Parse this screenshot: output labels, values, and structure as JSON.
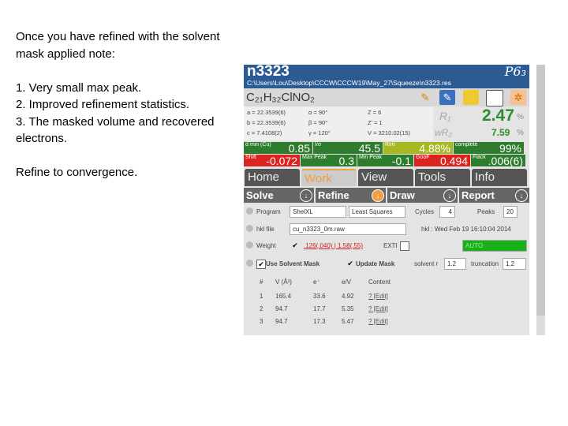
{
  "notes": {
    "intro": "Once you have refined with the solvent mask applied note:",
    "items": [
      "1.   Very small max peak.",
      "2.   Improved refinement statistics.",
      "3. The masked volume and recovered electrons."
    ],
    "outro": "Refine to convergence."
  },
  "header": {
    "title": "n3323",
    "path": "C:\\Users\\Lou\\Desktop\\CCCW\\CCCW19\\May_27\\Squeeze\\n3323.res",
    "space_group": "P6₃",
    "color": "#2c5b94"
  },
  "formula": "C₂₁H₃₂ClNO₂",
  "toolbar_icons": [
    "pencil-icon",
    "edit-structure-icon",
    "folder-icon",
    "notepad-icon",
    "molecule-icon"
  ],
  "cell": {
    "a": "a = 22.3539(6)",
    "b": "b = 22.3539(6)",
    "c": "c = 7.4108(2)",
    "alpha": "α = 90°",
    "beta": "β = 90°",
    "gamma": "γ = 120°",
    "Z": "Z = 6",
    "Zp": "Z' = 1",
    "V": "V = 3210.02(15)"
  },
  "r_factors": {
    "r1_label": "R₁",
    "r1": "2.47",
    "wr2_label": "wR₂",
    "wr2": "7.59",
    "unit": "%"
  },
  "stats_row1": [
    {
      "label": "d min (Cu)",
      "value": "0.85",
      "color": "#2e7d2e"
    },
    {
      "label": "I/σ",
      "value": "45.5",
      "color": "#2e7d2e"
    },
    {
      "label": "Rint",
      "value": "4.88%",
      "color": "#a8b820"
    },
    {
      "label": "complete",
      "value": "99%",
      "color": "#2e7d2e"
    }
  ],
  "stats_row2": [
    {
      "label": "Shift",
      "value": "-0.072",
      "color": "#d22"
    },
    {
      "label": "Max Peak",
      "value": "0.3",
      "color": "#2e7d2e"
    },
    {
      "label": "Min Peak",
      "value": "-0.1",
      "color": "#2e7d2e"
    },
    {
      "label": "GooF",
      "value": "0.494",
      "color": "#d22"
    },
    {
      "label": "Flack",
      "value": ".006(6)",
      "color": "#2e7d2e"
    }
  ],
  "tabs": [
    "Home",
    "Work",
    "View",
    "Tools",
    "Info"
  ],
  "active_tab": "Work",
  "subtabs": [
    "Solve",
    "Refine",
    "Draw",
    "Report"
  ],
  "refine": {
    "program_label": "Program",
    "program": "ShelXL",
    "method": "Least Squares",
    "cycles_label": "Cycles",
    "cycles": "4",
    "peaks_label": "Peaks",
    "peaks": "20",
    "hkl_label": "hkl file",
    "hkl": "cu_n3323_0m.raw",
    "hkl_date": "hkl : Wed Feb 19 16:10:04 2014",
    "weight_label": "Weight",
    "weight": ".126(.040) | 1.58(.55)",
    "exti_label": "EXTI",
    "auto": "AUTO",
    "use_mask": "Use Solvent Mask",
    "update_mask": "Update Mask",
    "solvent_r_label": "solvent r",
    "solvent_r": "1.2",
    "truncation_label": "truncation",
    "truncation": "1.2"
  },
  "mask_table": {
    "headers": [
      "#",
      "V (Å³)",
      "e⁻",
      "e/V",
      "Content"
    ],
    "rows": [
      [
        "1",
        "165.4",
        "33.6",
        "4.92",
        "? [Edit]"
      ],
      [
        "2",
        "94.7",
        "17.7",
        "5.35",
        "? [Edit]"
      ],
      [
        "3",
        "94.7",
        "17.3",
        "5.47",
        "? [Edit]"
      ]
    ]
  }
}
